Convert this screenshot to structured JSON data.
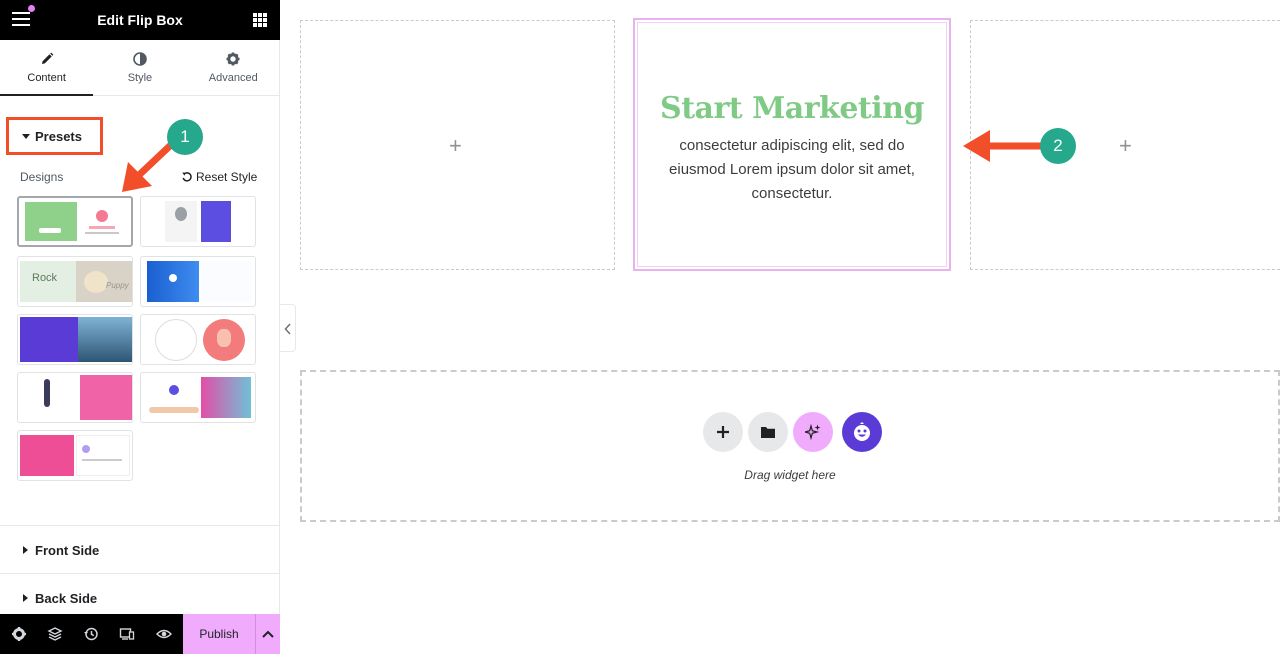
{
  "topbar": {
    "title": "Edit Flip Box"
  },
  "tabs": [
    {
      "label": "Content",
      "icon": "pencil-icon"
    },
    {
      "label": "Style",
      "icon": "half-circle-icon"
    },
    {
      "label": "Advanced",
      "icon": "gear-icon"
    }
  ],
  "presets": {
    "heading": "Presets",
    "designs_label": "Designs",
    "reset_label": "Reset Style",
    "thumb_texts": {
      "rock": "Rock",
      "puppy": "Puppy"
    }
  },
  "sections": {
    "front": "Front Side",
    "back": "Back Side"
  },
  "footer": {
    "publish": "Publish"
  },
  "flipbox": {
    "title": "Start Marketing",
    "description": "consectetur adipiscing elit, sed do eiusmod Lorem ipsum dolor sit amet, consectetur.",
    "title_color": "#7fca84"
  },
  "dropzone": {
    "text": "Drag widget here"
  },
  "annotations": {
    "badge1": "1",
    "badge2": "2",
    "color": "#f24e2a",
    "badge_color": "#26a88c"
  },
  "colors": {
    "accent": "#f0abfc",
    "selection": "#e6b3ec"
  }
}
